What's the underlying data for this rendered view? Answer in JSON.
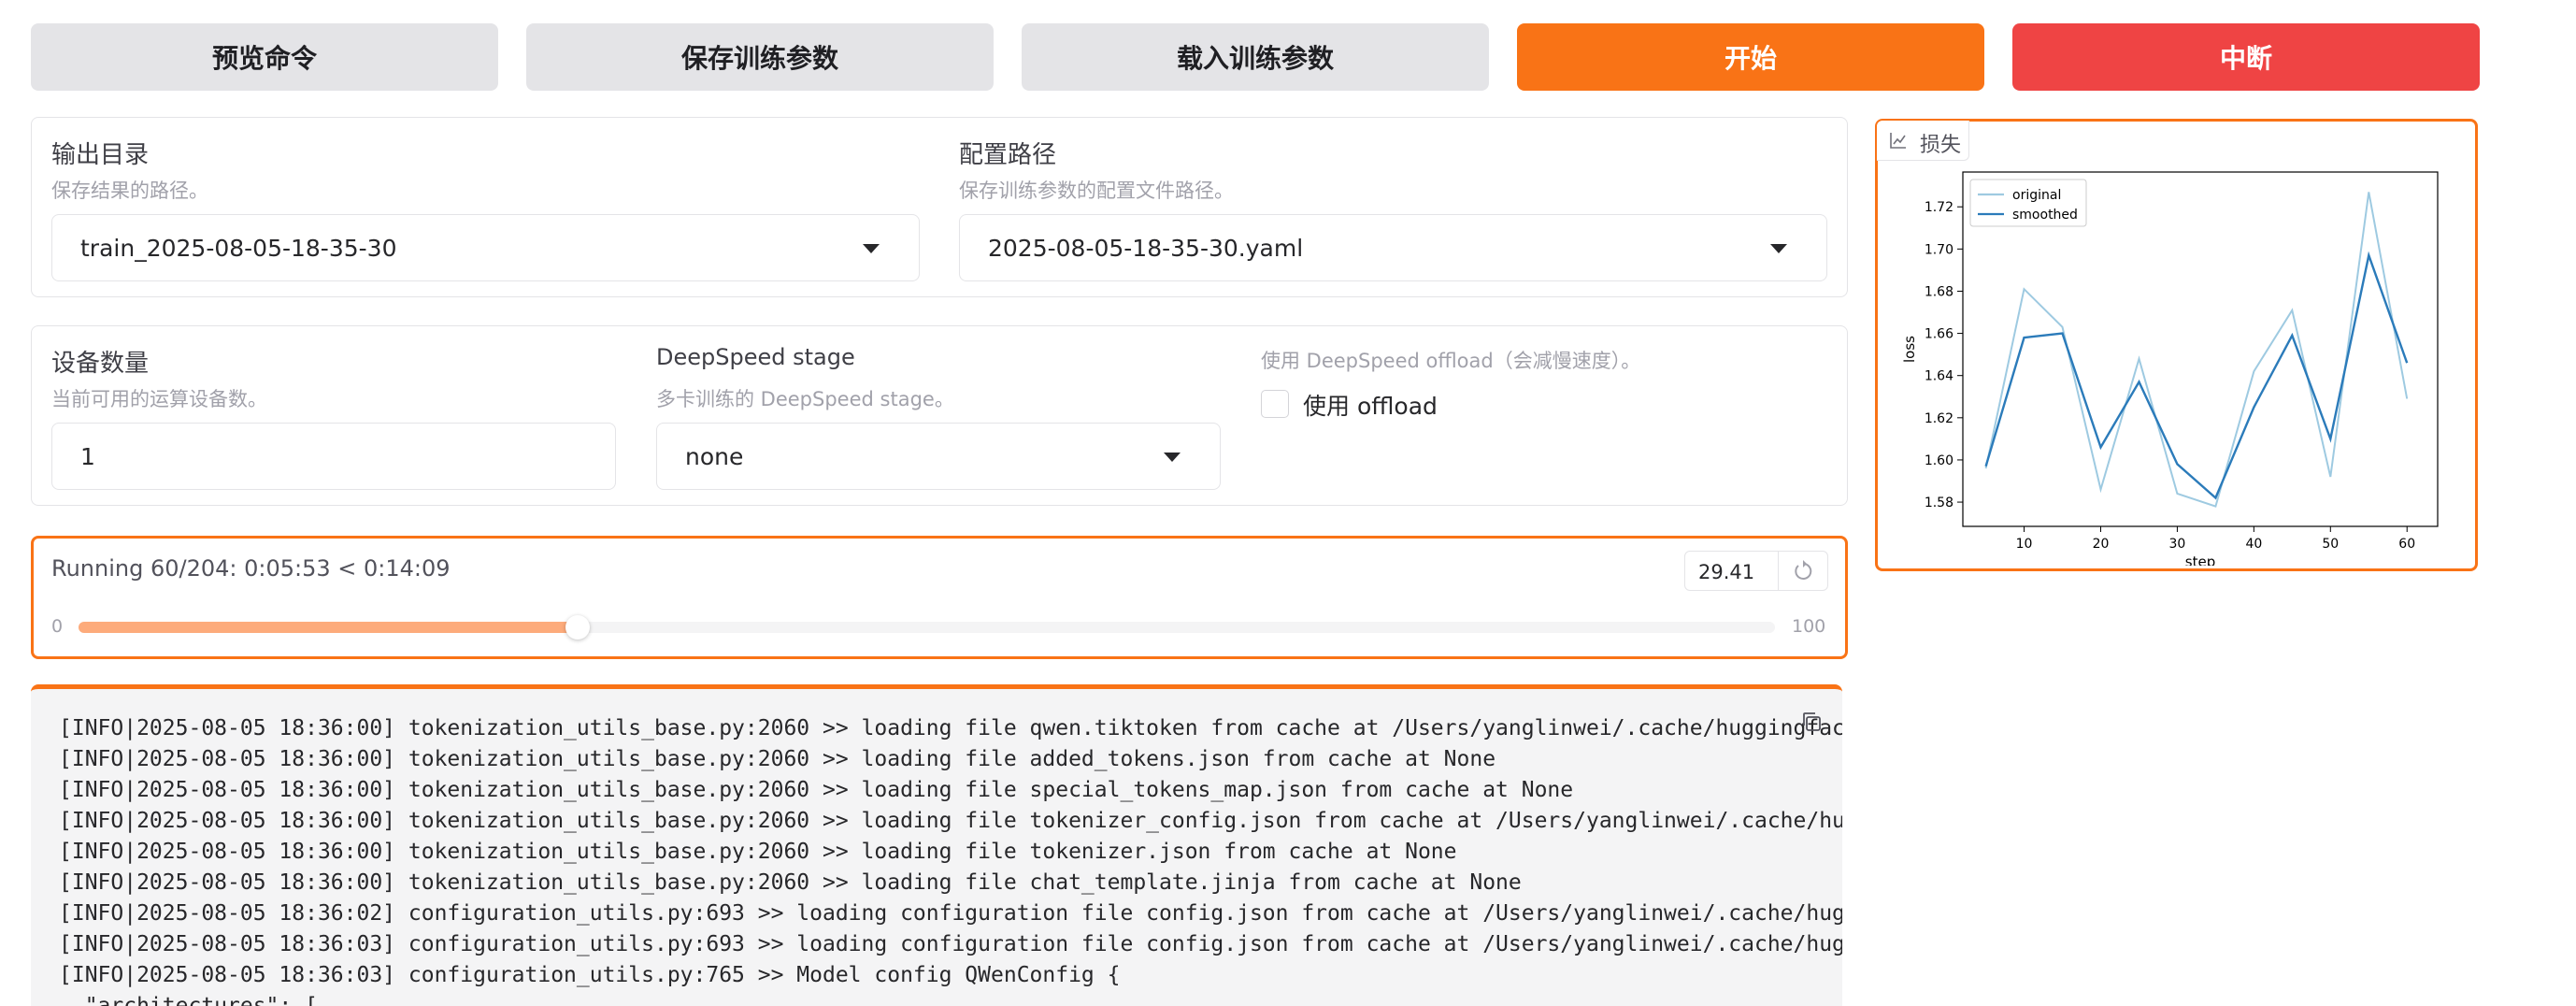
{
  "toolbar": {
    "preview_label": "预览命令",
    "save_label": "保存训练参数",
    "load_label": "载入训练参数",
    "start_label": "开始",
    "abort_label": "中断"
  },
  "paths": {
    "output_dir": {
      "label": "输出目录",
      "info": "保存结果的路径。",
      "value": "train_2025-08-05-18-35-30"
    },
    "config_path": {
      "label": "配置路径",
      "info": "保存训练参数的配置文件路径。",
      "value": "2025-08-05-18-35-30.yaml"
    }
  },
  "devices": {
    "device_count": {
      "label": "设备数量",
      "info": "当前可用的运算设备数。",
      "value": "1"
    },
    "ds_stage": {
      "label": "DeepSpeed stage",
      "info": "多卡训练的 DeepSpeed stage。",
      "value": "none"
    },
    "ds_offload": {
      "info": "使用 DeepSpeed offload（会减慢速度）。",
      "checkbox_label": "使用 offload",
      "checked": false
    }
  },
  "progress": {
    "status": "Running 60/204: 0:05:53 < 0:14:09",
    "value_text": "29.41",
    "value": 29.41,
    "min_label": "0",
    "max_label": "100",
    "reset_icon": "reset-icon"
  },
  "loss_panel": {
    "label": "损失",
    "icon": "line-chart-icon"
  },
  "chart_data": {
    "type": "line",
    "xlabel": "step",
    "ylabel": "loss",
    "xlim": [
      2,
      64
    ],
    "ylim": [
      1.5685,
      1.7365
    ],
    "xticks": [
      "10",
      "20",
      "30",
      "40",
      "50",
      "60"
    ],
    "yticks": [
      "1.58",
      "1.60",
      "1.62",
      "1.64",
      "1.66",
      "1.68",
      "1.70",
      "1.72"
    ],
    "x": [
      5,
      10,
      15,
      20,
      25,
      30,
      35,
      40,
      45,
      50,
      55,
      60
    ],
    "series": [
      {
        "name": "original",
        "color": "#9ecae1",
        "values": [
          1.596,
          1.681,
          1.663,
          1.586,
          1.648,
          1.584,
          1.578,
          1.642,
          1.671,
          1.592,
          1.727,
          1.629
        ]
      },
      {
        "name": "smoothed",
        "color": "#2b7bba",
        "values": [
          1.597,
          1.658,
          1.66,
          1.606,
          1.637,
          1.598,
          1.582,
          1.625,
          1.659,
          1.61,
          1.697,
          1.646
        ]
      }
    ],
    "legend": "top-left"
  },
  "log": {
    "copy_icon": "copy-icon",
    "lines": [
      "[INFO|2025-08-05 18:36:00] tokenization_utils_base.py:2060 >> loading file qwen.tiktoken from cache at /Users/yanglinwei/.cache/huggingface/hub/mod",
      "[INFO|2025-08-05 18:36:00] tokenization_utils_base.py:2060 >> loading file added_tokens.json from cache at None",
      "[INFO|2025-08-05 18:36:00] tokenization_utils_base.py:2060 >> loading file special_tokens_map.json from cache at None",
      "[INFO|2025-08-05 18:36:00] tokenization_utils_base.py:2060 >> loading file tokenizer_config.json from cache at /Users/yanglinwei/.cache/huggingface",
      "[INFO|2025-08-05 18:36:00] tokenization_utils_base.py:2060 >> loading file tokenizer.json from cache at None",
      "[INFO|2025-08-05 18:36:00] tokenization_utils_base.py:2060 >> loading file chat_template.jinja from cache at None",
      "[INFO|2025-08-05 18:36:02] configuration_utils.py:693 >> loading configuration file config.json from cache at /Users/yanglinwei/.cache/huggingface/",
      "[INFO|2025-08-05 18:36:03] configuration_utils.py:693 >> loading configuration file config.json from cache at /Users/yanglinwei/.cache/huggingface/",
      "[INFO|2025-08-05 18:36:03] configuration_utils.py:765 >> Model config QWenConfig {",
      "  \"architectures\": ["
    ]
  },
  "colors": {
    "accent": "#f97316",
    "danger": "#ef4444",
    "neutral_button": "#e4e4e7",
    "progress_fill": "#fdab7b"
  }
}
